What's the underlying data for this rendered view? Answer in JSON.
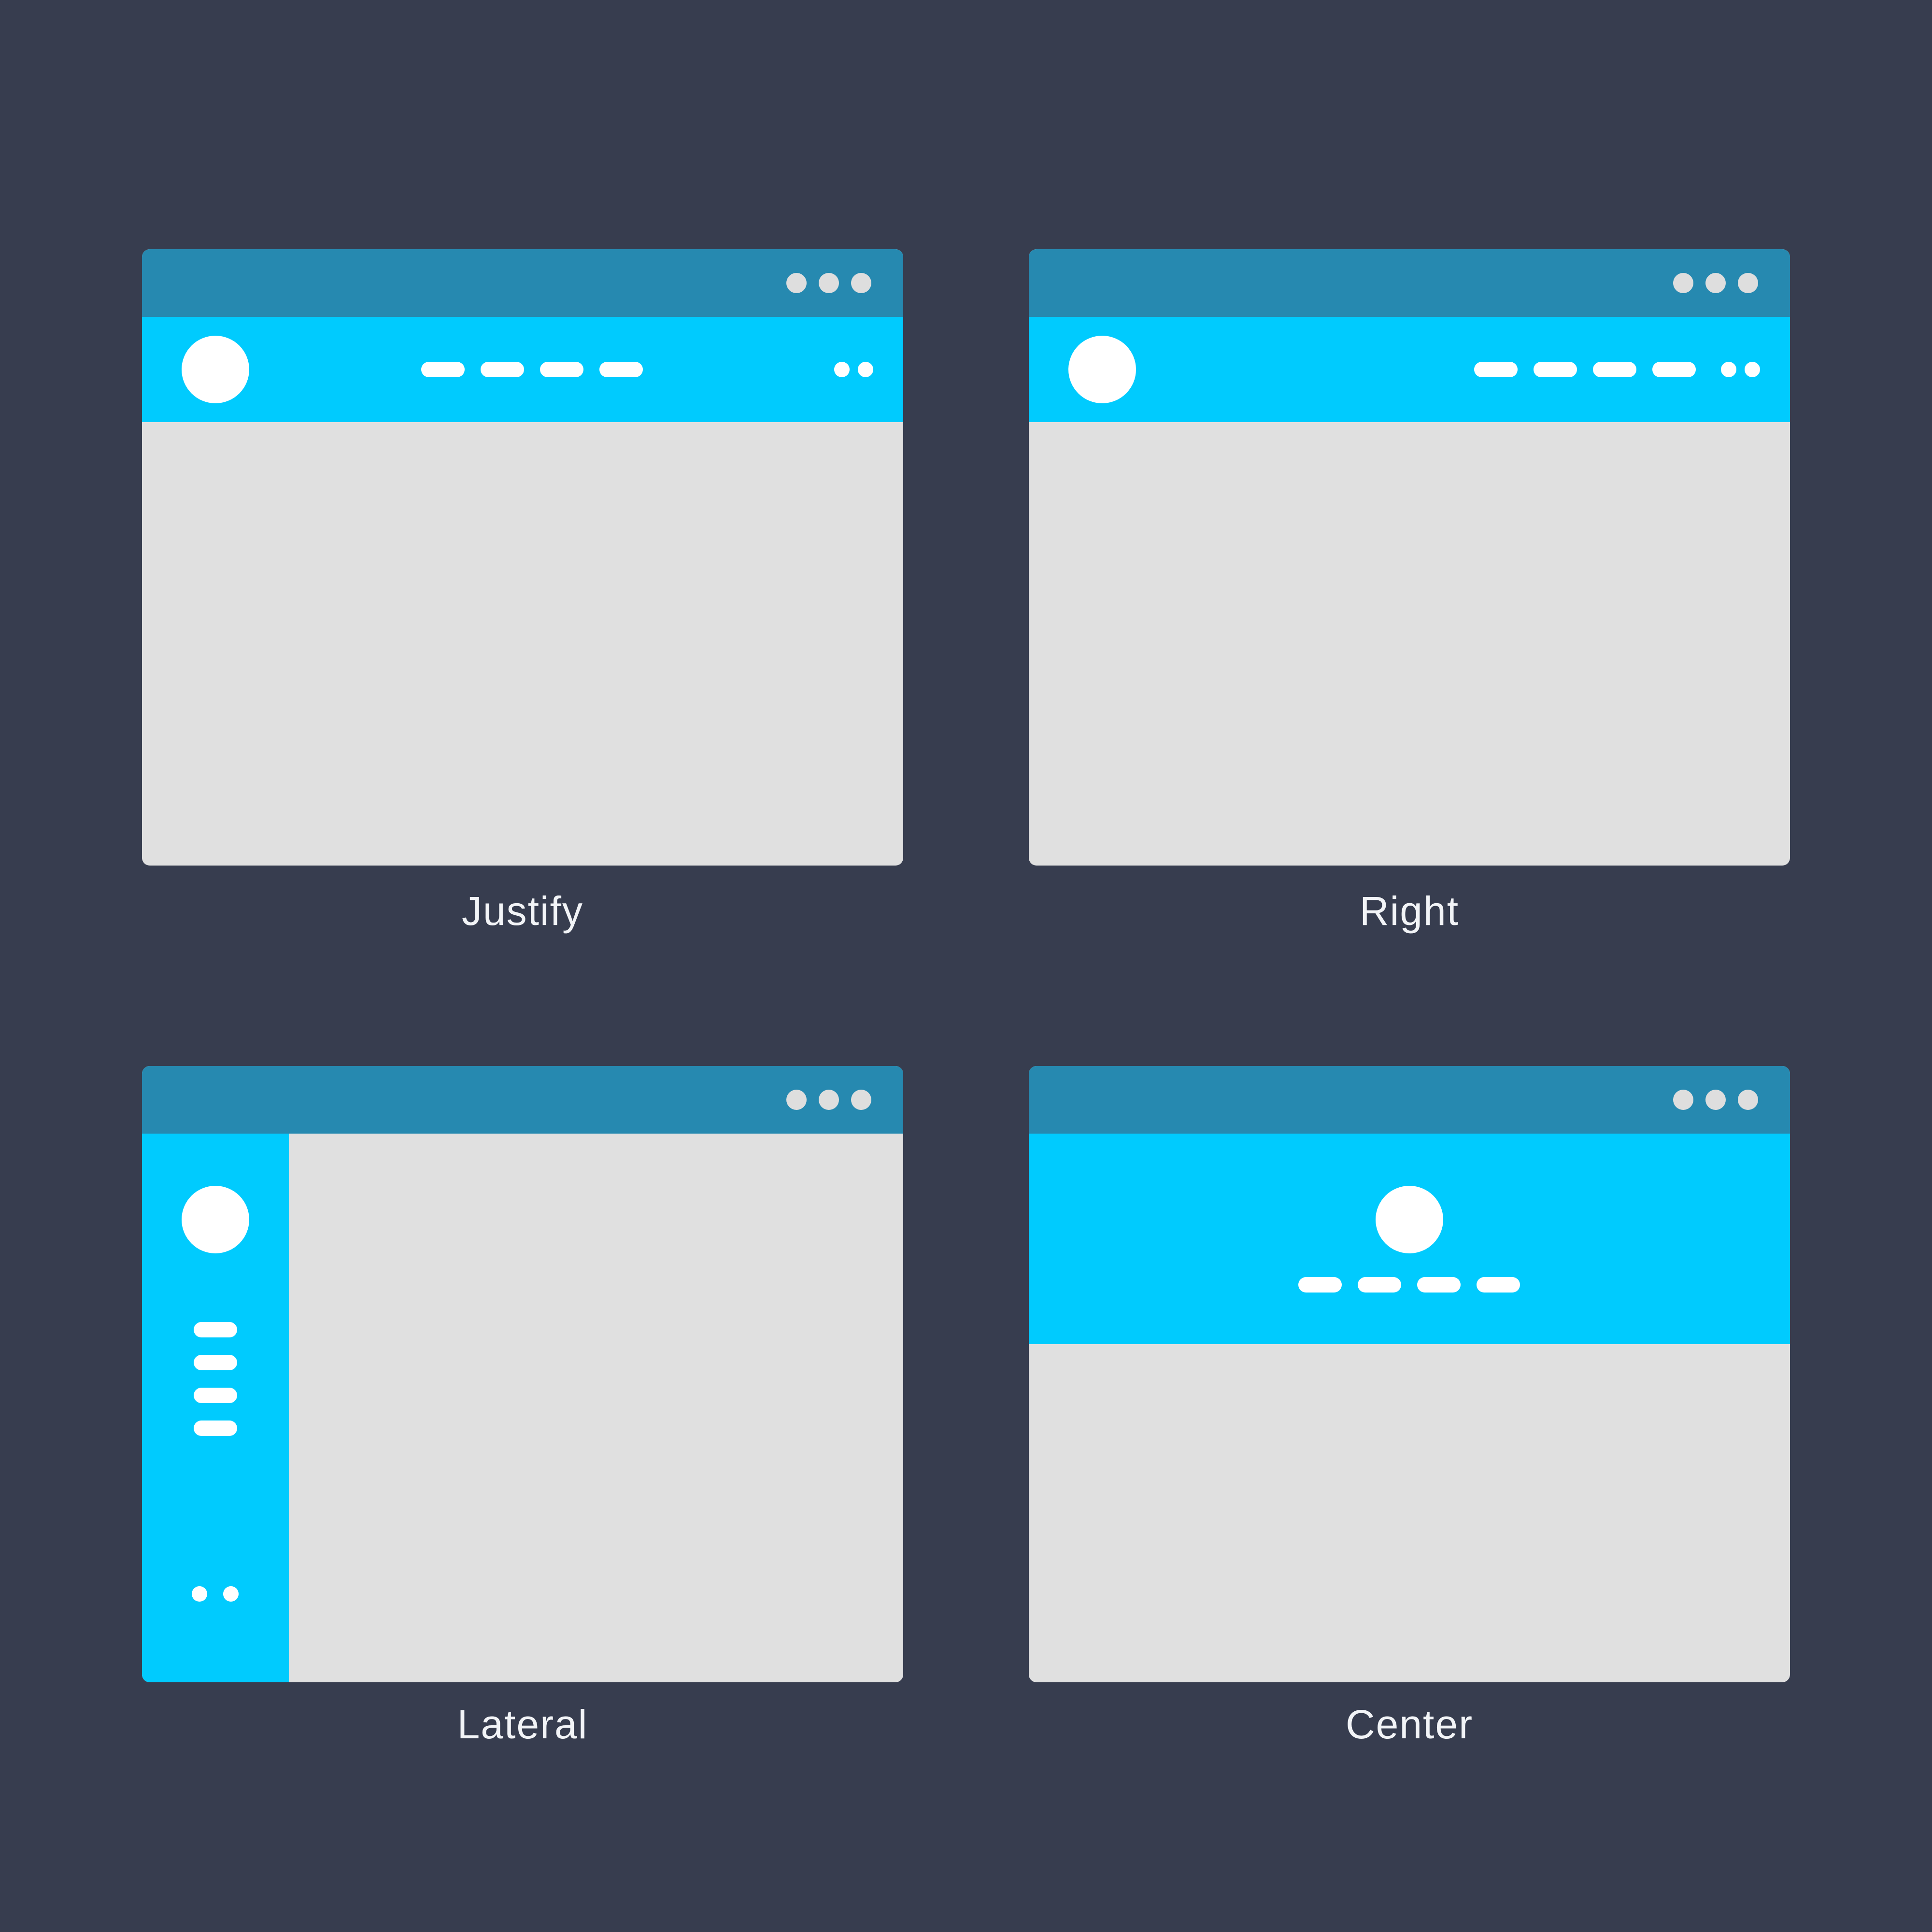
{
  "layouts": [
    {
      "key": "justify",
      "label": "Justify"
    },
    {
      "key": "right",
      "label": "Right"
    },
    {
      "key": "lateral",
      "label": "Lateral"
    },
    {
      "key": "center",
      "label": "Center"
    }
  ],
  "colors": {
    "background": "#373d4f",
    "titlebar": "#2689b0",
    "navbar": "#00cbfe",
    "content": "#e0e0e0",
    "element": "#ffffff",
    "window_dots": "#dedede"
  },
  "icons": {
    "logo": "logo-circle-icon",
    "menu_item": "menu-pill-icon",
    "small_item": "small-dot-icon",
    "window_control": "window-dot-icon"
  }
}
